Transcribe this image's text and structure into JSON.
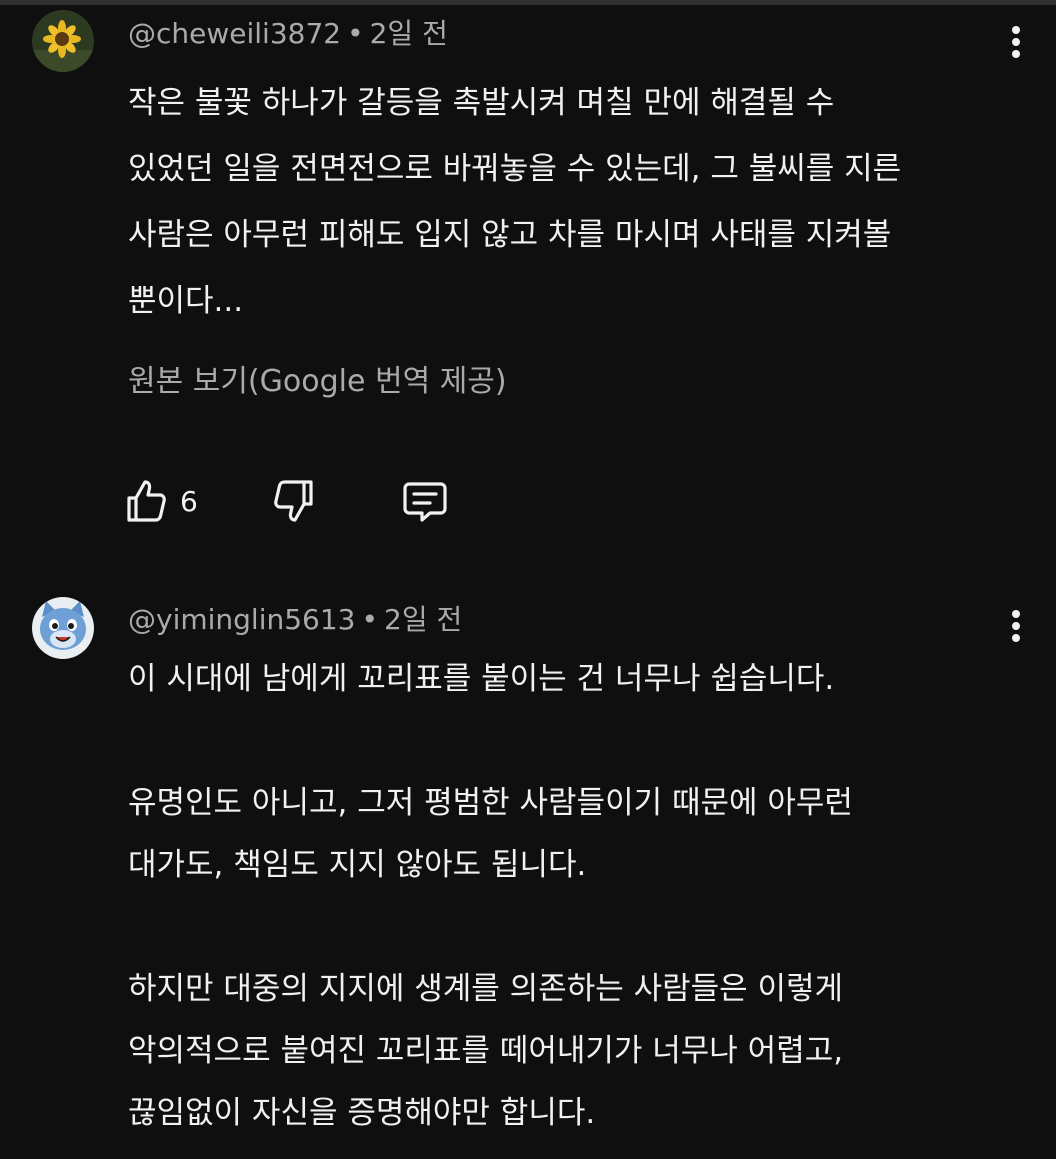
{
  "comments": [
    {
      "handle": "@cheweili3872",
      "separator": "•",
      "time": "2일 전",
      "lines": [
        "작은 불꽃 하나가 갈등을 촉발시켜 며칠 만에 해결될 수",
        "있었던 일을 전면전으로 바꿔놓을 수 있는데, 그 불씨를 지른",
        "사람은 아무런 피해도 입지 않고 차를 마시며 사태를 지켜볼",
        "뿐이다..."
      ],
      "translate_label": "원본 보기(Google 번역 제공)",
      "like_count": "6",
      "avatar_icon": "sunflower-avatar"
    },
    {
      "handle": "@yiminglin5613",
      "separator": "•",
      "time": "2일 전",
      "lines": [
        "이 시대에 남에게 꼬리표를 붙이는 건 너무나 쉽습니다.",
        "",
        "유명인도 아니고, 그저 평범한 사람들이기 때문에 아무런",
        "대가도, 책임도 지지 않아도 됩니다.",
        "",
        "하지만 대중의 지지에 생계를 의존하는 사람들은 이렇게",
        "악의적으로 붙여진 꼬리표를 떼어내기가 너무나 어렵고,",
        "끊임없이 자신을 증명해야만 합니다."
      ],
      "avatar_icon": "blue-cat-avatar"
    }
  ],
  "colors": {
    "background": "#0f0f0f",
    "text": "#f1f1f1",
    "secondary_text": "#aaaaaa"
  }
}
